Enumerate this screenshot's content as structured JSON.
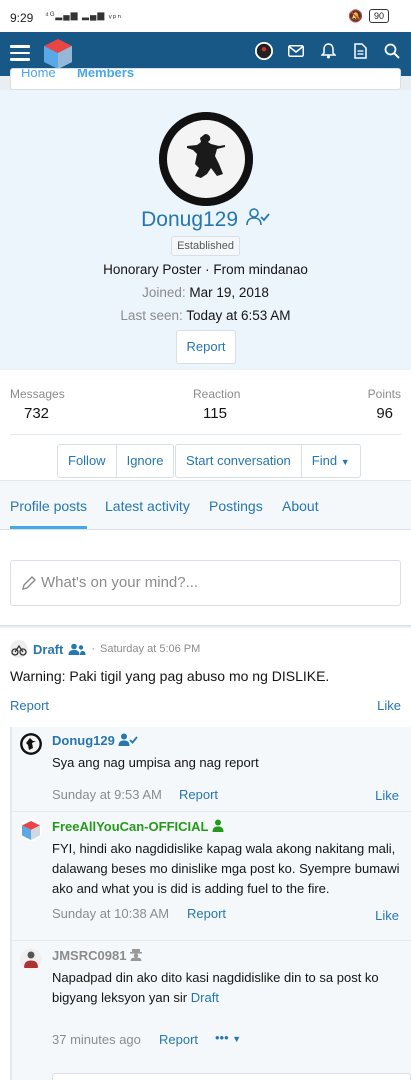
{
  "status_bar": {
    "time": "9:29",
    "battery": "90"
  },
  "profile": {
    "username": "Donug129",
    "badge": "Established",
    "title_line": "Honorary Poster · From mindanao",
    "joined_label": "Joined:",
    "joined_value": "Mar 19, 2018",
    "last_seen_label": "Last seen:",
    "last_seen_value": "Today at 6:53 AM",
    "report_label": "Report"
  },
  "stats": {
    "messages_label": "Messages",
    "messages_value": "732",
    "reaction_label": "Reaction",
    "reaction_value": "115",
    "points_label": "Points",
    "points_value": "96"
  },
  "actions": {
    "follow": "Follow",
    "ignore": "Ignore",
    "start_conversation": "Start conversation",
    "find": "Find"
  },
  "tabs": [
    "Profile posts",
    "Latest activity",
    "Postings",
    "About"
  ],
  "composer": {
    "placeholder": "What's on your mind?..."
  },
  "post": {
    "author": "Draft",
    "time": "Saturday at 5:06 PM",
    "text": "Warning: Paki tigil yang pag abuso mo ng DISLIKE.",
    "report": "Report",
    "like": "Like"
  },
  "comments": [
    {
      "author": "Donug129",
      "text": "Sya ang nag umpisa ang nag report",
      "time": "Sunday at 9:53 AM",
      "report": "Report",
      "like": "Like"
    },
    {
      "author": "FreeAllYouCan-OFFICIAL",
      "text": "FYI, hindi ako nagdidislike kapag wala akong nakitang mali, dalawang beses mo dinislike mga post ko. Syempre bumawi ako and what you is did is adding fuel to the fire.",
      "time": "Sunday at 10:38 AM",
      "report": "Report",
      "like": "Like"
    },
    {
      "author": "JMSRC0981",
      "text": "Napadpad din ako dito kasi nagdidislike din to sa post ko bigyang leksyon yan sir",
      "mention": "Draft",
      "time": "37 minutes ago",
      "report": "Report",
      "more": "•••"
    }
  ],
  "colors": {
    "navbar": "#185886",
    "link": "#2577b1",
    "accent": "#47a7eb",
    "staff_green": "#259a1a",
    "header_bg": "#ecf4fc"
  }
}
